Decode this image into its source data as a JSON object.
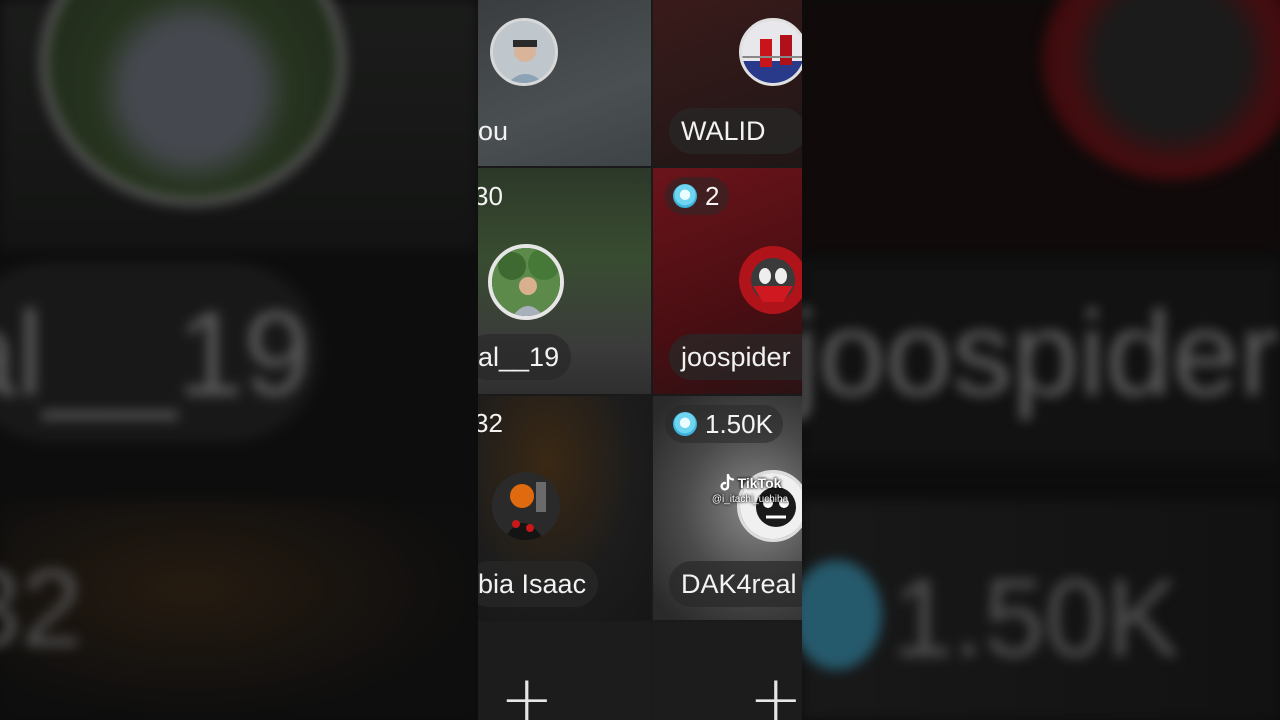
{
  "tiles": [
    {
      "id": "t1",
      "name": "ou",
      "count": ""
    },
    {
      "id": "t2",
      "name": "WALID",
      "count": ""
    },
    {
      "id": "t3",
      "name": "al__19",
      "count": "30"
    },
    {
      "id": "t4",
      "name": "joospider",
      "count": "2"
    },
    {
      "id": "t5",
      "name": "bia Isaac",
      "count": "32"
    },
    {
      "id": "t6",
      "name": "DAK4real",
      "count": "1.50K"
    }
  ],
  "add_buttons": [
    "+",
    "+"
  ],
  "watermark": {
    "brand": "TikTok",
    "handle": "@i_itachi_uchiha"
  },
  "background_left": {
    "name": "al__19",
    "count": "32"
  },
  "background_right": {
    "name": "joospider",
    "count": "1.50K"
  },
  "colors": {
    "gem": "#4fc3e8",
    "pill_bg": "#282828",
    "text": "#f2f2f2"
  }
}
